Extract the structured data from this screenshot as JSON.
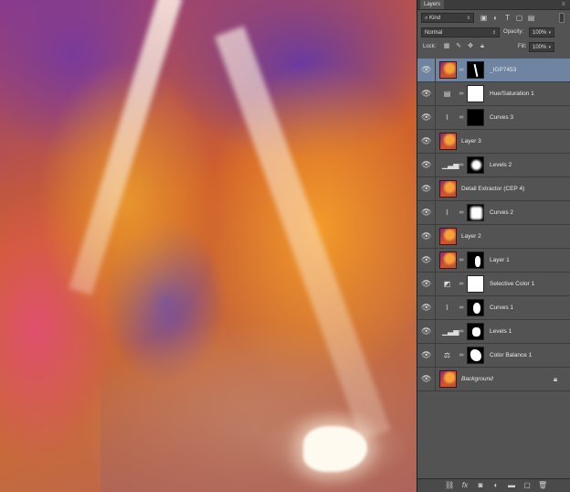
{
  "panel": {
    "tab": "Layers",
    "filter_kind": "Kind",
    "blend_mode": "Normal",
    "opacity_label": "Opacity:",
    "opacity_value": "100%",
    "lock_label": "Lock:",
    "fill_label": "Fill:",
    "fill_value": "100%"
  },
  "layers": [
    {
      "name": "_IGP7453",
      "selected": true
    },
    {
      "name": "Hue/Saturation 1"
    },
    {
      "name": "Curves 3"
    },
    {
      "name": "Layer 3"
    },
    {
      "name": "Levels 2"
    },
    {
      "name": "Detail Extractor  (CEP 4)"
    },
    {
      "name": "Curves 2"
    },
    {
      "name": "Layer 2"
    },
    {
      "name": "Layer 1"
    },
    {
      "name": "Selective Color 1"
    },
    {
      "name": "Curves 1"
    },
    {
      "name": "Levels 1"
    },
    {
      "name": "Color Balance 1"
    },
    {
      "name": "Background",
      "italic": true,
      "locked": true
    }
  ],
  "colors": {
    "panel_bg": "#535353",
    "selected_row": "#6f84a0",
    "canvas_bg": "#2b2b2b"
  }
}
